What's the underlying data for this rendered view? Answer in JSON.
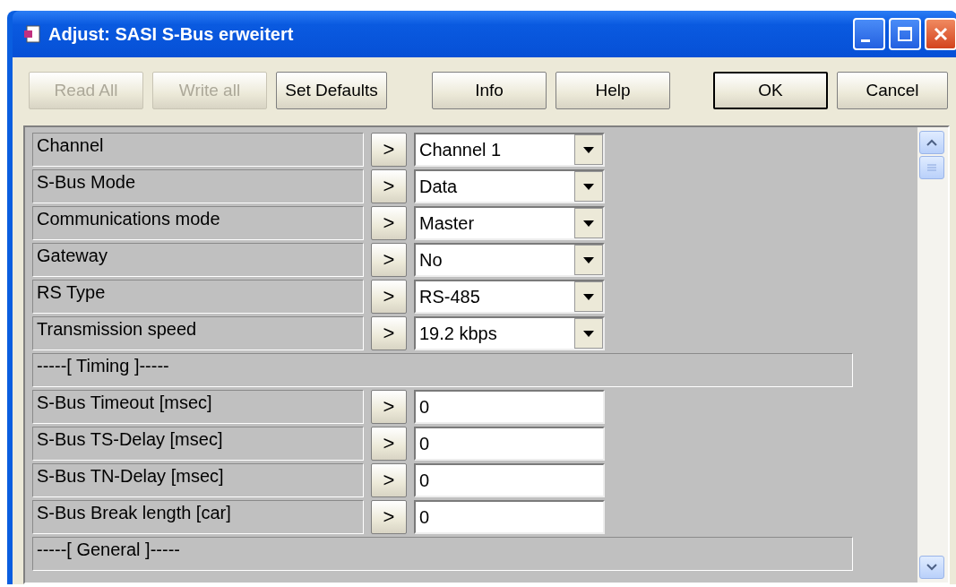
{
  "window": {
    "title": "Adjust: SASI S-Bus erweitert"
  },
  "toolbar": [
    {
      "label": "Read All",
      "disabled": true,
      "default": false
    },
    {
      "label": "Write all",
      "disabled": true,
      "default": false
    },
    {
      "label": "Set Defaults",
      "disabled": false,
      "default": false
    },
    {
      "label": "Info",
      "disabled": false,
      "default": false
    },
    {
      "label": "Help",
      "disabled": false,
      "default": false
    },
    {
      "label": "OK",
      "disabled": false,
      "default": true
    },
    {
      "label": "Cancel",
      "disabled": false,
      "default": false
    }
  ],
  "parameters": [
    {
      "kind": "select",
      "label": "Channel",
      "button": ">",
      "value": "Channel 1"
    },
    {
      "kind": "select",
      "label": "S-Bus Mode",
      "button": ">",
      "value": "Data"
    },
    {
      "kind": "select",
      "label": "Communications mode",
      "button": ">",
      "value": "Master"
    },
    {
      "kind": "select",
      "label": "Gateway",
      "button": ">",
      "value": "No"
    },
    {
      "kind": "select",
      "label": "RS Type",
      "button": ">",
      "value": "RS-485"
    },
    {
      "kind": "select",
      "label": "Transmission speed",
      "button": ">",
      "value": "19.2 kbps"
    },
    {
      "kind": "section",
      "label": "-----[ Timing ]-----"
    },
    {
      "kind": "text",
      "label": "S-Bus Timeout [msec]",
      "button": ">",
      "value": "0"
    },
    {
      "kind": "text",
      "label": "S-Bus TS-Delay [msec]",
      "button": ">",
      "value": "0"
    },
    {
      "kind": "text",
      "label": "S-Bus TN-Delay [msec]",
      "button": ">",
      "value": "0"
    },
    {
      "kind": "text",
      "label": "S-Bus Break length [car]",
      "button": ">",
      "value": "0"
    },
    {
      "kind": "section",
      "label": "-----[ General ]-----"
    }
  ]
}
